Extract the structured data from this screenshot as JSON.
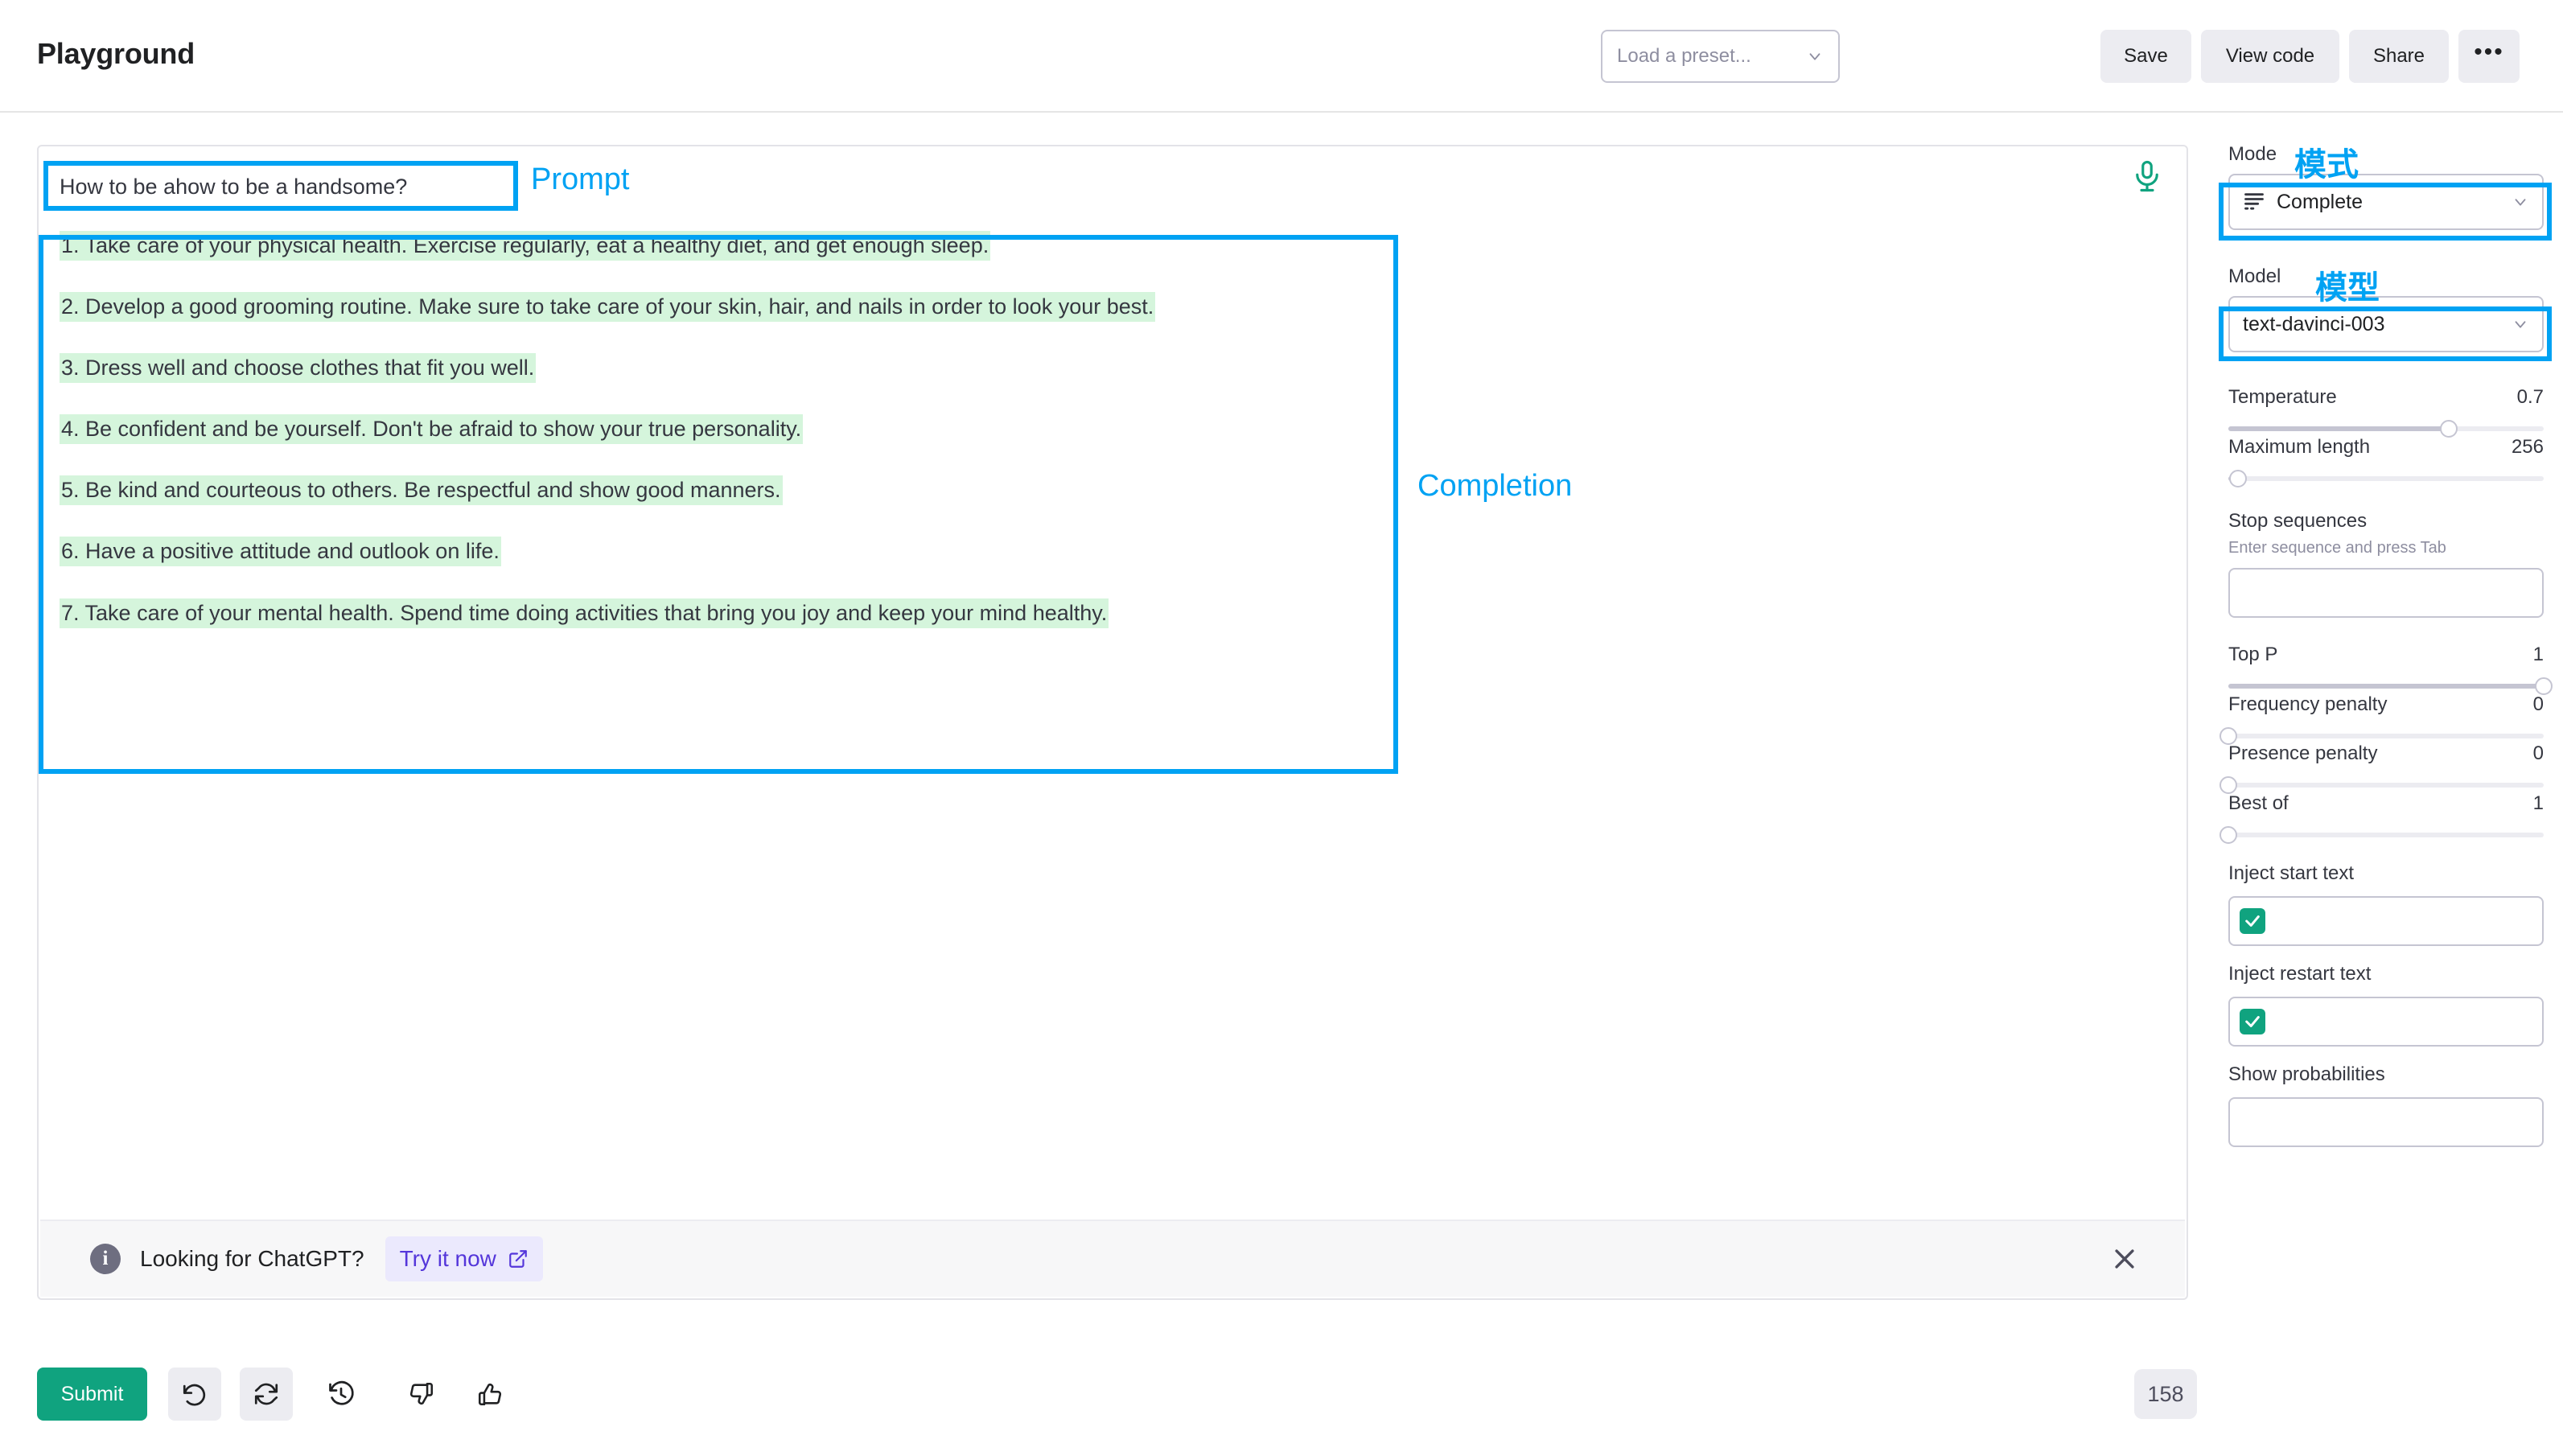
{
  "header": {
    "title": "Playground",
    "preset_placeholder": "Load a preset...",
    "save_label": "Save",
    "view_code_label": "View code",
    "share_label": "Share",
    "more_label": "•••"
  },
  "editor": {
    "prompt": "How to be ahow to be a handsome?",
    "completion_lines": [
      "1. Take care of your physical health. Exercise regularly, eat a healthy diet, and get enough sleep.",
      "2. Develop a good grooming routine. Make sure to take care of your skin, hair, and nails in order to look your best.",
      "3. Dress well and choose clothes that fit you well.",
      "4. Be confident and be yourself. Don't be afraid to show your true personality.",
      "5. Be kind and courteous to others. Be respectful and show good manners.",
      "6. Have a positive attitude and outlook on life.",
      "7. Take care of your mental health. Spend time doing activities that bring you joy and keep your mind healthy."
    ]
  },
  "banner": {
    "message": "Looking for ChatGPT?",
    "cta_label": "Try it now"
  },
  "actions": {
    "submit_label": "Submit",
    "token_count": "158"
  },
  "sidebar": {
    "mode_label": "Mode",
    "mode_value": "Complete",
    "model_label": "Model",
    "model_value": "text-davinci-003",
    "temperature_label": "Temperature",
    "temperature_value": "0.7",
    "max_length_label": "Maximum length",
    "max_length_value": "256",
    "stop_sequences_label": "Stop sequences",
    "stop_sequences_hint": "Enter sequence and press Tab",
    "top_p_label": "Top P",
    "top_p_value": "1",
    "frequency_penalty_label": "Frequency penalty",
    "frequency_penalty_value": "0",
    "presence_penalty_label": "Presence penalty",
    "presence_penalty_value": "0",
    "best_of_label": "Best of",
    "best_of_value": "1",
    "inject_start_label": "Inject start text",
    "inject_restart_label": "Inject restart text",
    "show_probabilities_label": "Show probabilities"
  },
  "annotations": {
    "prompt_label": "Prompt",
    "completion_label": "Completion",
    "mode_cjk": "模式",
    "model_cjk": "模型",
    "color": "#00a2f3"
  },
  "colors": {
    "accent_green": "#10a37f",
    "highlight_green": "#d5f5dc",
    "cta_purple": "#5436da",
    "annotation_cyan": "#00a2f3"
  }
}
